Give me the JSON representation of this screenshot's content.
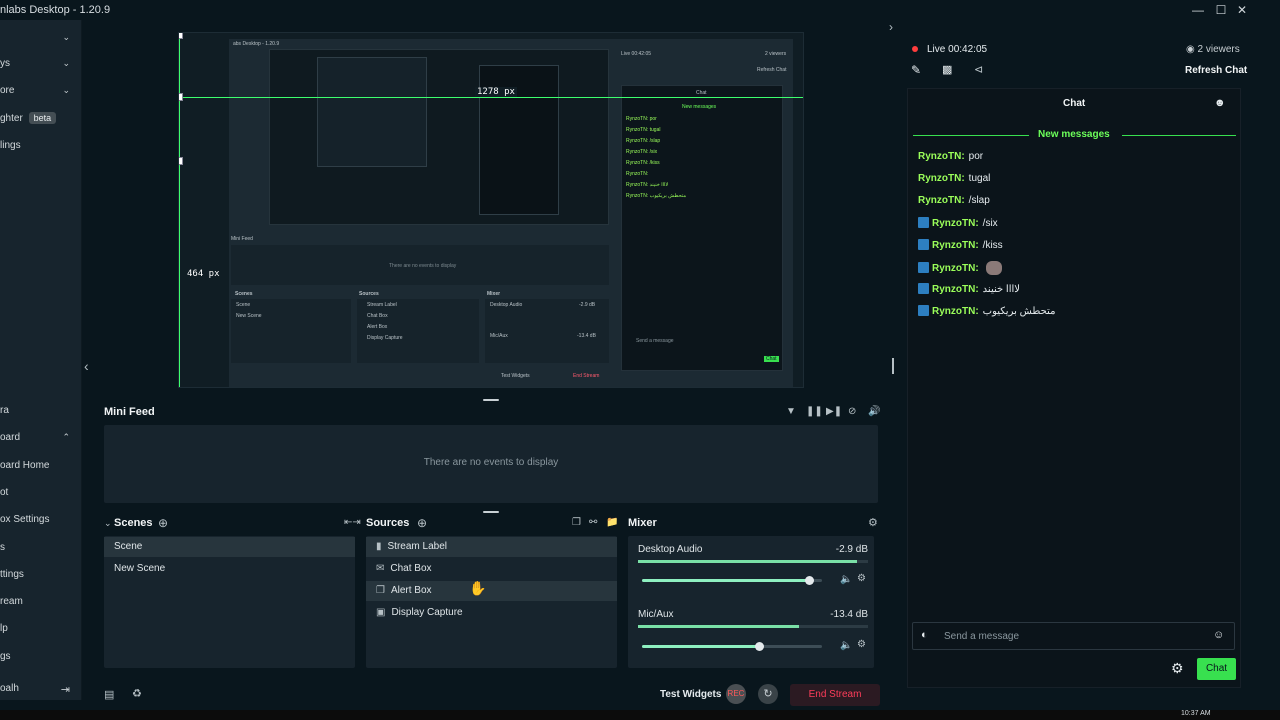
{
  "window": {
    "title": "nlabs Desktop - 1.20.9",
    "controls": [
      "minimize-icon",
      "maximize-icon",
      "close-icon"
    ]
  },
  "sidebar": {
    "items": [
      {
        "label": "",
        "chevron": "chevron-down-icon"
      },
      {
        "label": "ys",
        "chevron": "chevron-down-icon"
      },
      {
        "label": "ore",
        "chevron": "chevron-down-icon"
      },
      {
        "label": "ghter",
        "badge": "beta"
      },
      {
        "label": "lings"
      }
    ],
    "bottom_items": [
      {
        "label": "ra"
      },
      {
        "label": "oard",
        "chevron": "chevron-up-icon"
      },
      {
        "label": "oard Home"
      },
      {
        "label": "ot"
      },
      {
        "label": "ox Settings"
      },
      {
        "label": "s"
      },
      {
        "label": "ttings"
      },
      {
        "label": "ream"
      },
      {
        "label": "lp"
      },
      {
        "label": "gs"
      },
      {
        "label": "oalh"
      }
    ]
  },
  "preview": {
    "width_label": "1278 px",
    "height_label": "464 px",
    "nested": {
      "title": "abs Desktop - 1.20.9",
      "mini_feed": "Mini Feed",
      "empty": "There are no events to display",
      "scenes": "Scenes",
      "sources": "Sources",
      "mixer": "Mixer",
      "scene_items": [
        "Scene",
        "New Scene"
      ],
      "source_items": [
        "Stream Label",
        "Chat Box",
        "Alert Box",
        "Display Capture"
      ],
      "desktop_audio": "Desktop Audio",
      "desktop_db": "-2.9 dB",
      "mic_aux": "Mic/Aux",
      "mic_db": "-13.4 dB",
      "test_widgets": "Test Widgets",
      "end_stream": "End Stream",
      "live": "Live 00:42:05",
      "viewers": "2 viewers",
      "refresh": "Refresh Chat",
      "chat": "Chat",
      "new_messages": "New messages",
      "send_placeholder": "Send a message",
      "chat_btn": "Chat",
      "chat_lines": [
        "RynzoTN: por",
        "RynzoTN: tugal",
        "RynzoTN: /slap",
        "RynzoTN: /six",
        "RynzoTN: /kiss",
        "RynzoTN:",
        "RynzoTN: لاااا خنيند",
        "RynzoTN: متحطش بريكيوب"
      ]
    }
  },
  "mini_feed": {
    "title": "Mini Feed",
    "empty_text": "There are no events to display",
    "controls": [
      "filter-icon",
      "pause-icon",
      "skip-icon",
      "mute-alerts-icon",
      "volume-icon"
    ]
  },
  "scenes": {
    "title": "Scenes",
    "items": [
      {
        "label": "Scene",
        "selected": true
      },
      {
        "label": "New Scene",
        "selected": false
      }
    ]
  },
  "sources": {
    "title": "Sources",
    "items": [
      {
        "label": "Stream Label",
        "icon": "file-icon",
        "selected": true
      },
      {
        "label": "Chat Box",
        "icon": "chat-icon",
        "selected": false
      },
      {
        "label": "Alert Box",
        "icon": "alert-icon",
        "selected": true
      },
      {
        "label": "Display Capture",
        "icon": "monitor-icon",
        "selected": false
      }
    ]
  },
  "mixer": {
    "title": "Mixer",
    "channels": [
      {
        "name": "Desktop Audio",
        "db": "-2.9 dB",
        "level": 0.95,
        "volume": 0.93
      },
      {
        "name": "Mic/Aux",
        "db": "-13.4 dB",
        "level": 0.7,
        "volume": 0.65
      }
    ]
  },
  "footer": {
    "test_widgets": "Test Widgets",
    "rec_label": "REC",
    "end_stream": "End Stream"
  },
  "chat": {
    "live_label": "Live",
    "live_time": "00:42:05",
    "viewers": "2 viewers",
    "refresh": "Refresh Chat",
    "title": "Chat",
    "new_messages": "New messages",
    "messages": [
      {
        "user": "RynzoTN:",
        "text": "por",
        "badge": false,
        "emote": false
      },
      {
        "user": "RynzoTN:",
        "text": "tugal",
        "badge": false,
        "emote": false
      },
      {
        "user": "RynzoTN:",
        "text": "/slap",
        "badge": false,
        "emote": false
      },
      {
        "user": "RynzoTN:",
        "text": "/six",
        "badge": true,
        "emote": false
      },
      {
        "user": "RynzoTN:",
        "text": "/kiss",
        "badge": true,
        "emote": false
      },
      {
        "user": "RynzoTN:",
        "text": "",
        "badge": true,
        "emote": true
      },
      {
        "user": "RynzoTN:",
        "text": "لاااا خنيند",
        "badge": true,
        "emote": false
      },
      {
        "user": "RynzoTN:",
        "text": "متحطش بريكيوب",
        "badge": true,
        "emote": false
      }
    ],
    "input_placeholder": "Send a message",
    "send_label": "Chat"
  },
  "taskbar": {
    "clock": "10:37 AM"
  },
  "colors": {
    "accent_green": "#38e04f",
    "name_green": "#9bff5a",
    "live_red": "#ff3d3d",
    "end_stream_red": "#ff3d5a",
    "guide_green": "#3dff6e"
  }
}
